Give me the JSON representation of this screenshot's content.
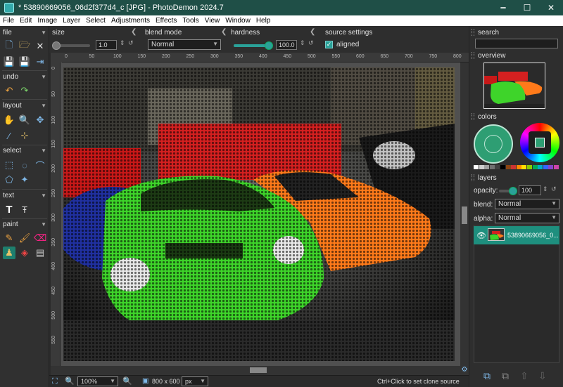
{
  "window": {
    "title": "* 53890669056_06d2f377d4_c [JPG] - PhotoDemon 2024.7",
    "minimize": "🗕",
    "maximize": "☐",
    "close": "✕"
  },
  "menu": [
    "File",
    "Edit",
    "Image",
    "Layer",
    "Select",
    "Adjustments",
    "Effects",
    "Tools",
    "View",
    "Window",
    "Help"
  ],
  "toolbox": {
    "sections": {
      "file": "file",
      "undo": "undo",
      "layout": "layout",
      "select": "select",
      "text": "text",
      "paint": "paint"
    }
  },
  "options": {
    "size_label": "size",
    "size_value": "1.0",
    "blend_label": "blend mode",
    "blend_value": "Normal",
    "hardness_label": "hardness",
    "hardness_value": "100.0",
    "hardness_level": 1.0,
    "source_label": "source settings",
    "aligned_label": "aligned",
    "aligned_checked": true
  },
  "rulers": {
    "h_ticks": [
      "0",
      "50",
      "100",
      "150",
      "200",
      "250",
      "300",
      "350",
      "400",
      "450",
      "500",
      "550",
      "600",
      "650",
      "700",
      "750",
      "800"
    ],
    "v_ticks": [
      "0",
      "50",
      "100",
      "150",
      "200",
      "250",
      "300",
      "350",
      "400",
      "450",
      "500",
      "550"
    ]
  },
  "status": {
    "zoom": "100%",
    "image_size": "800 x 600",
    "units": "px",
    "hint": "Ctrl+Click to set clone source"
  },
  "panel": {
    "search_label": "search",
    "overview_label": "overview",
    "colors_label": "colors",
    "layers_label": "layers",
    "opacity_label": "opacity:",
    "opacity_value": "100",
    "blend_label": "blend:",
    "blend_value": "Normal",
    "alpha_label": "alpha:",
    "alpha_value": "Normal",
    "layer_name": "53890669056_0..."
  },
  "colors": {
    "accent": "#2aa198",
    "titlebar": "#1f4f47",
    "primary_color": "#2e9e73",
    "palette": [
      "#ffffff",
      "#d0d0d0",
      "#a0a0a0",
      "#707070",
      "#404040",
      "#000000",
      "#8b4513",
      "#cc3333",
      "#ff8800",
      "#ffdd00",
      "#88cc00",
      "#00aa55",
      "#00aacc",
      "#3366ff",
      "#8844cc",
      "#cc44aa"
    ]
  }
}
